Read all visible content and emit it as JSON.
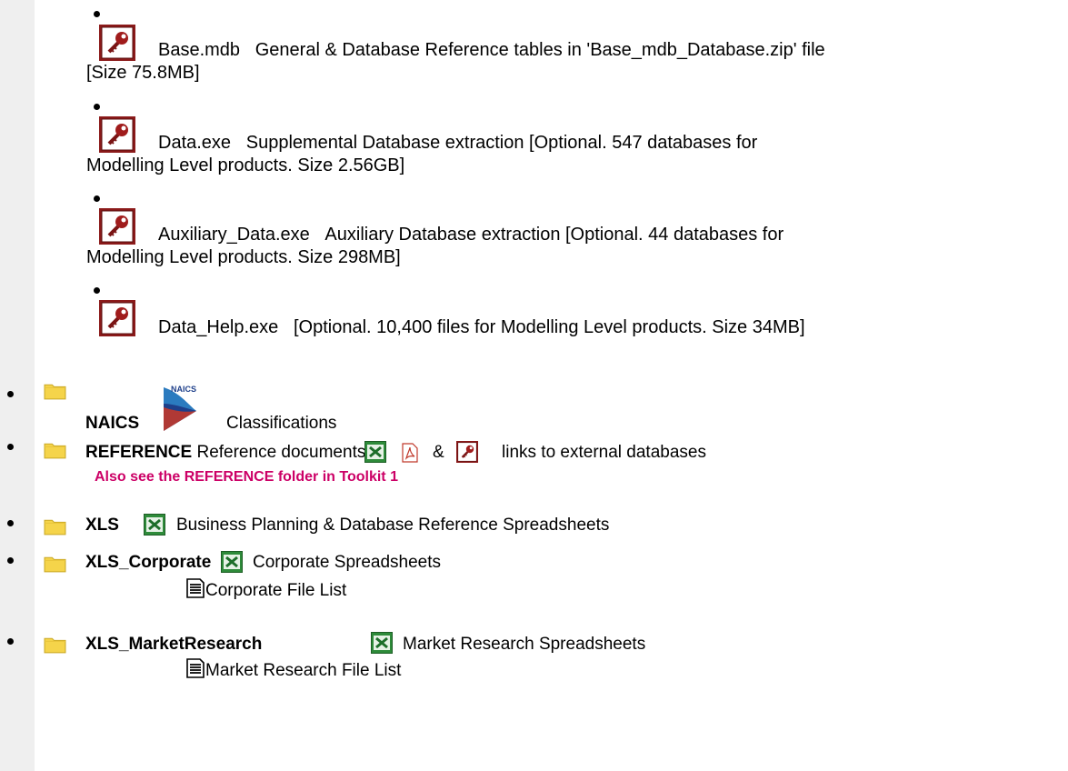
{
  "db_files": [
    {
      "name": "Base.mdb",
      "desc": "General & Database Reference tables in 'Base_mdb_Database.zip' file",
      "desc2": "[Size 75.8MB]"
    },
    {
      "name": "Data.exe",
      "desc": "Supplemental Database extraction [Optional. 547 databases for",
      "desc2": "Modelling Level products. Size 2.56GB]"
    },
    {
      "name": "Auxiliary_Data.exe",
      "desc": "Auxiliary Database extraction [Optional. 44 databases for",
      "desc2": "Modelling Level products. Size 298MB]"
    },
    {
      "name": "Data_Help.exe",
      "desc": "[Optional. 10,400 files for Modelling Level products. Size 34MB]"
    }
  ],
  "folders": {
    "naics": {
      "name": "NAICS",
      "desc": "Classifications",
      "logo_text": "NAICS"
    },
    "reference": {
      "name": "REFERENCE",
      "desc1": "Reference documents:",
      "amp": "&",
      "desc2": "links to external databases",
      "note": "Also see the REFERENCE folder in Toolkit 1"
    },
    "xls": {
      "name": "XLS",
      "desc": "Business Planning & Database Reference Spreadsheets"
    },
    "xls_corporate": {
      "name": "XLS_Corporate",
      "desc": "Corporate Spreadsheets",
      "sub": "Corporate File List"
    },
    "xls_market": {
      "name": "XLS_MarketResearch",
      "desc": "Market Research Spreadsheets",
      "sub": "Market Research File List"
    }
  },
  "colors": {
    "accent_link": "#cc0066",
    "access_icon": "#8b1a1a",
    "folder_icon": "#f5d44a",
    "excel_icon": "#2e8b3a",
    "sidebar": "#efefef"
  }
}
